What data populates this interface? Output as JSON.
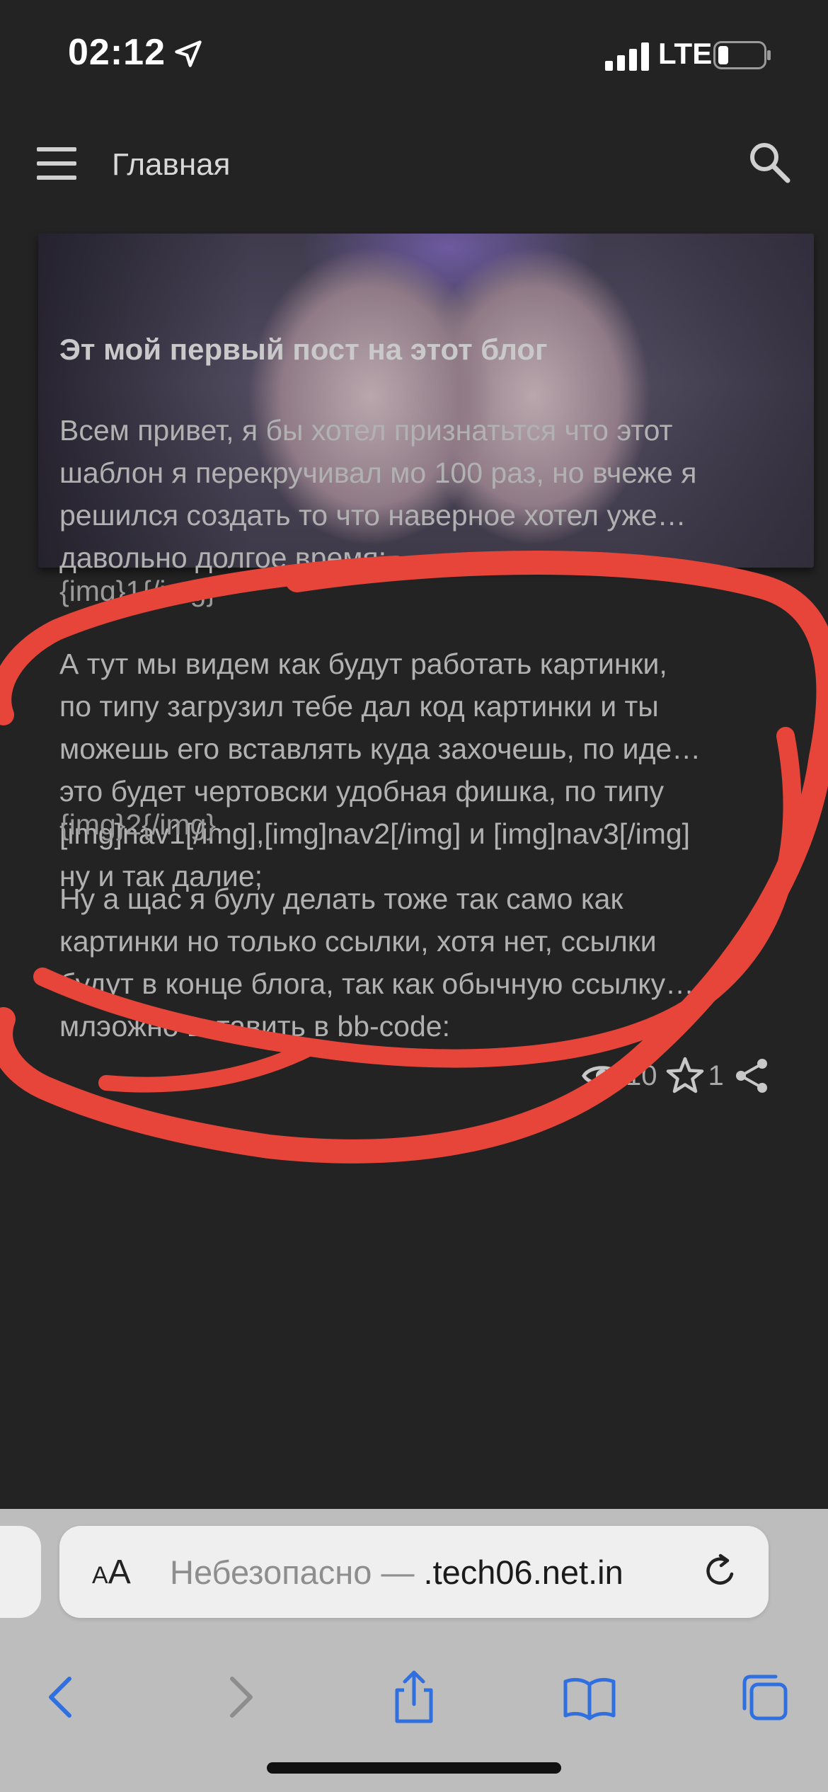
{
  "status": {
    "time": "02:12",
    "network": "LTE"
  },
  "appbar": {
    "title": "Главная",
    "menu_icon": "menu-icon",
    "search_icon": "search-icon"
  },
  "post": {
    "title": "Эт мой первый пост на этот блог",
    "paragraph1": [
      "Всем привет, я бы хотел признатьтся что этот",
      "шаблон я перекручивал мо 100 раз, но вчеже я",
      "решился создать то что наверное хотел уже…",
      "давольно долгое время;"
    ],
    "img_tag_1": "{img}1{/img}",
    "paragraph2": [
      "А тут мы видем как будут работать картинки,",
      "по типу загрузил тебе дал код картинки и ты",
      "можешь его вставлять куда захочешь, по иде…",
      "это будет чертовски удобная фишка, по типу",
      "[img]nav1[/img],[img]nav2[/img] и [img]nav3[/img]",
      "ну и так далие;"
    ],
    "img_tag_2": "{img}2{/img}",
    "paragraph3": [
      "Ну а щас я булу делать тоже так само как",
      "картинки но только ссылки, хотя нет, ссылки",
      "будут в конце блога, так как обычную ссылку…",
      "млэожно вставить в bb-code:"
    ],
    "views": "10",
    "stars": "1"
  },
  "safari": {
    "aa_big": "A",
    "aa_small": "A",
    "url_prefix": "Небезопасно — ",
    "url_domain": ".tech06.net.in",
    "accent": "#2f6fe0"
  },
  "colors": {
    "background": "#232323",
    "scribble": "#e8453a"
  }
}
